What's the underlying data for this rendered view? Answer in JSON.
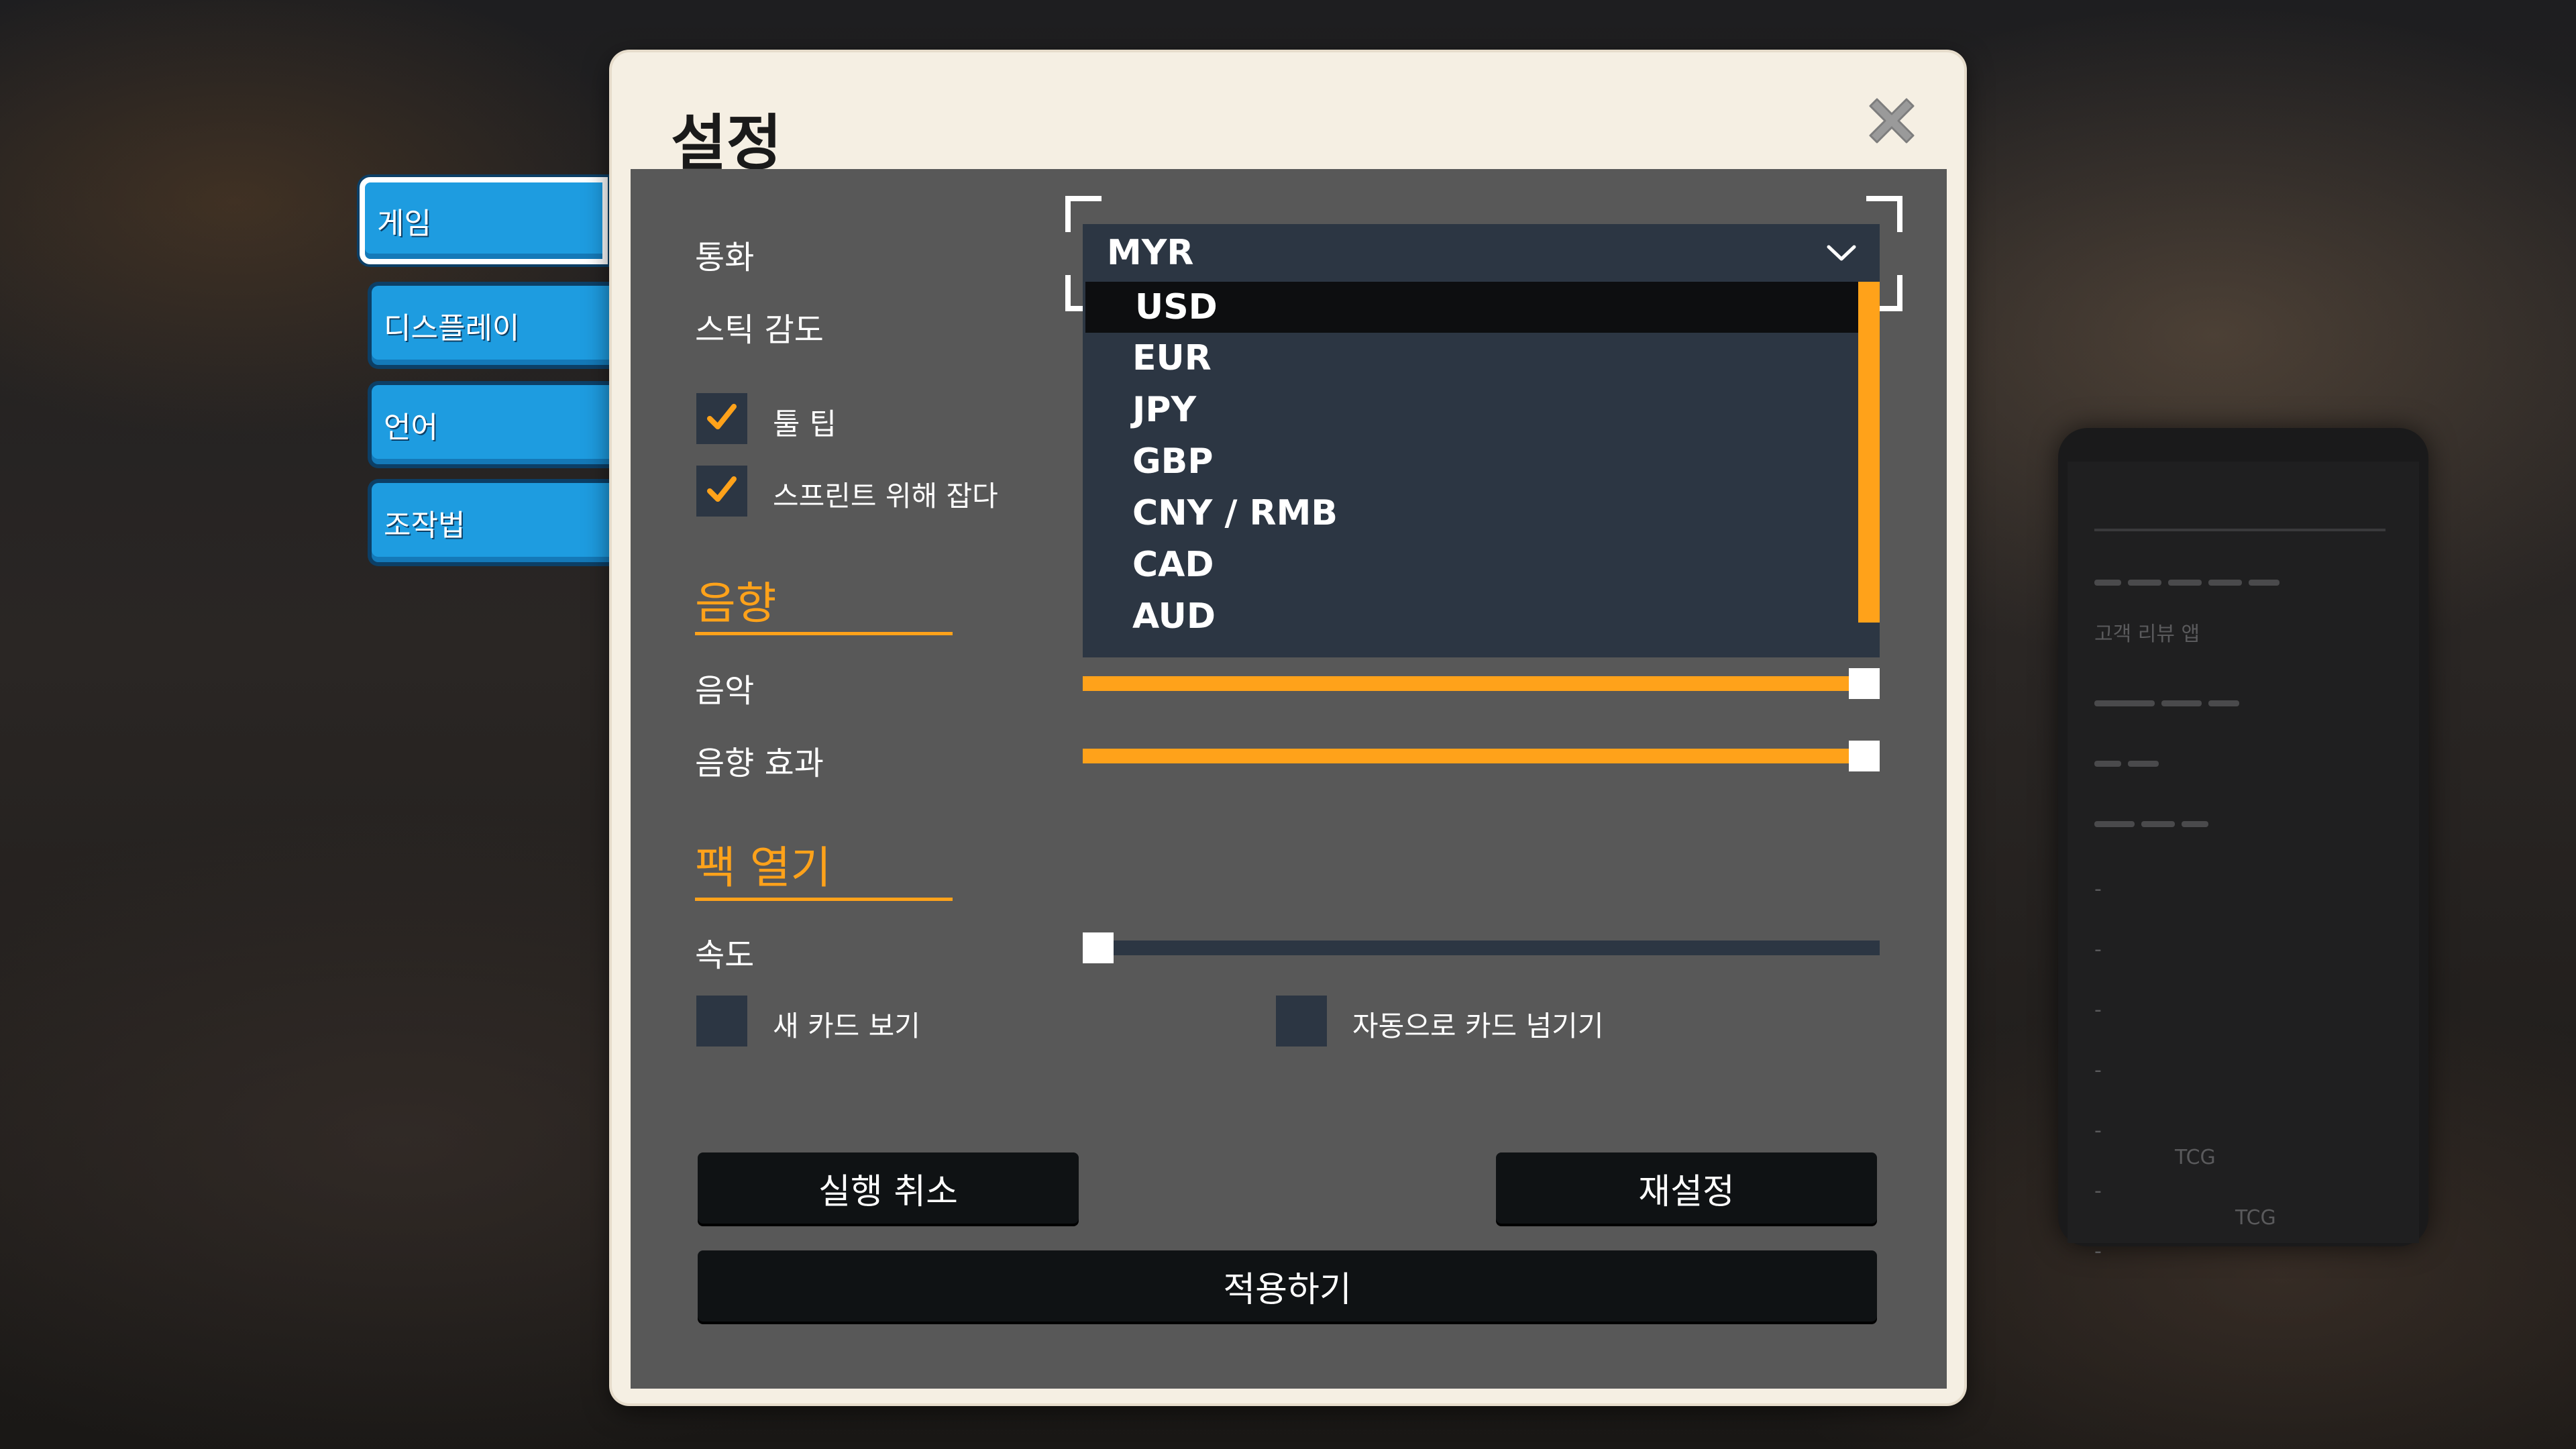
{
  "dialog": {
    "title": "설정"
  },
  "tabs": [
    {
      "label": "게임",
      "active": true
    },
    {
      "label": "디스플레이",
      "active": false
    },
    {
      "label": "언어",
      "active": false
    },
    {
      "label": "조작법",
      "active": false
    }
  ],
  "game": {
    "currency_label": "통화",
    "stick_sensitivity_label": "스틱 감도",
    "tooltip": {
      "label": "툴 팁",
      "checked": true
    },
    "hold_to_sprint": {
      "label": "스프린트 위해 잡다",
      "checked": true
    }
  },
  "currency_dropdown": {
    "selected": "MYR",
    "highlighted": "USD",
    "options": [
      "USD",
      "EUR",
      "JPY",
      "GBP",
      "CNY / RMB",
      "CAD",
      "AUD"
    ]
  },
  "sound": {
    "heading": "음향",
    "music": {
      "label": "음악",
      "value": 1.0
    },
    "sfx": {
      "label": "음향 효과",
      "value": 1.0
    }
  },
  "pack_opening": {
    "heading": "팩 열기",
    "speed": {
      "label": "속도",
      "value": 0.0
    },
    "show_new_cards": {
      "label": "새 카드 보기",
      "checked": false
    },
    "auto_flip_cards": {
      "label": "자동으로 카드 넘기기",
      "checked": false
    }
  },
  "buttons": {
    "cancel": "실행 취소",
    "reset": "재설정",
    "apply": "적용하기"
  },
  "background_phone": {
    "app_label": "고객 리뷰 앱",
    "items": [
      "TCG",
      "TCG"
    ]
  },
  "colors": {
    "accent": "#ffa21a",
    "tab_blue": "#1e9ce0",
    "panel": "#585858",
    "control_dark": "#2c3643"
  }
}
